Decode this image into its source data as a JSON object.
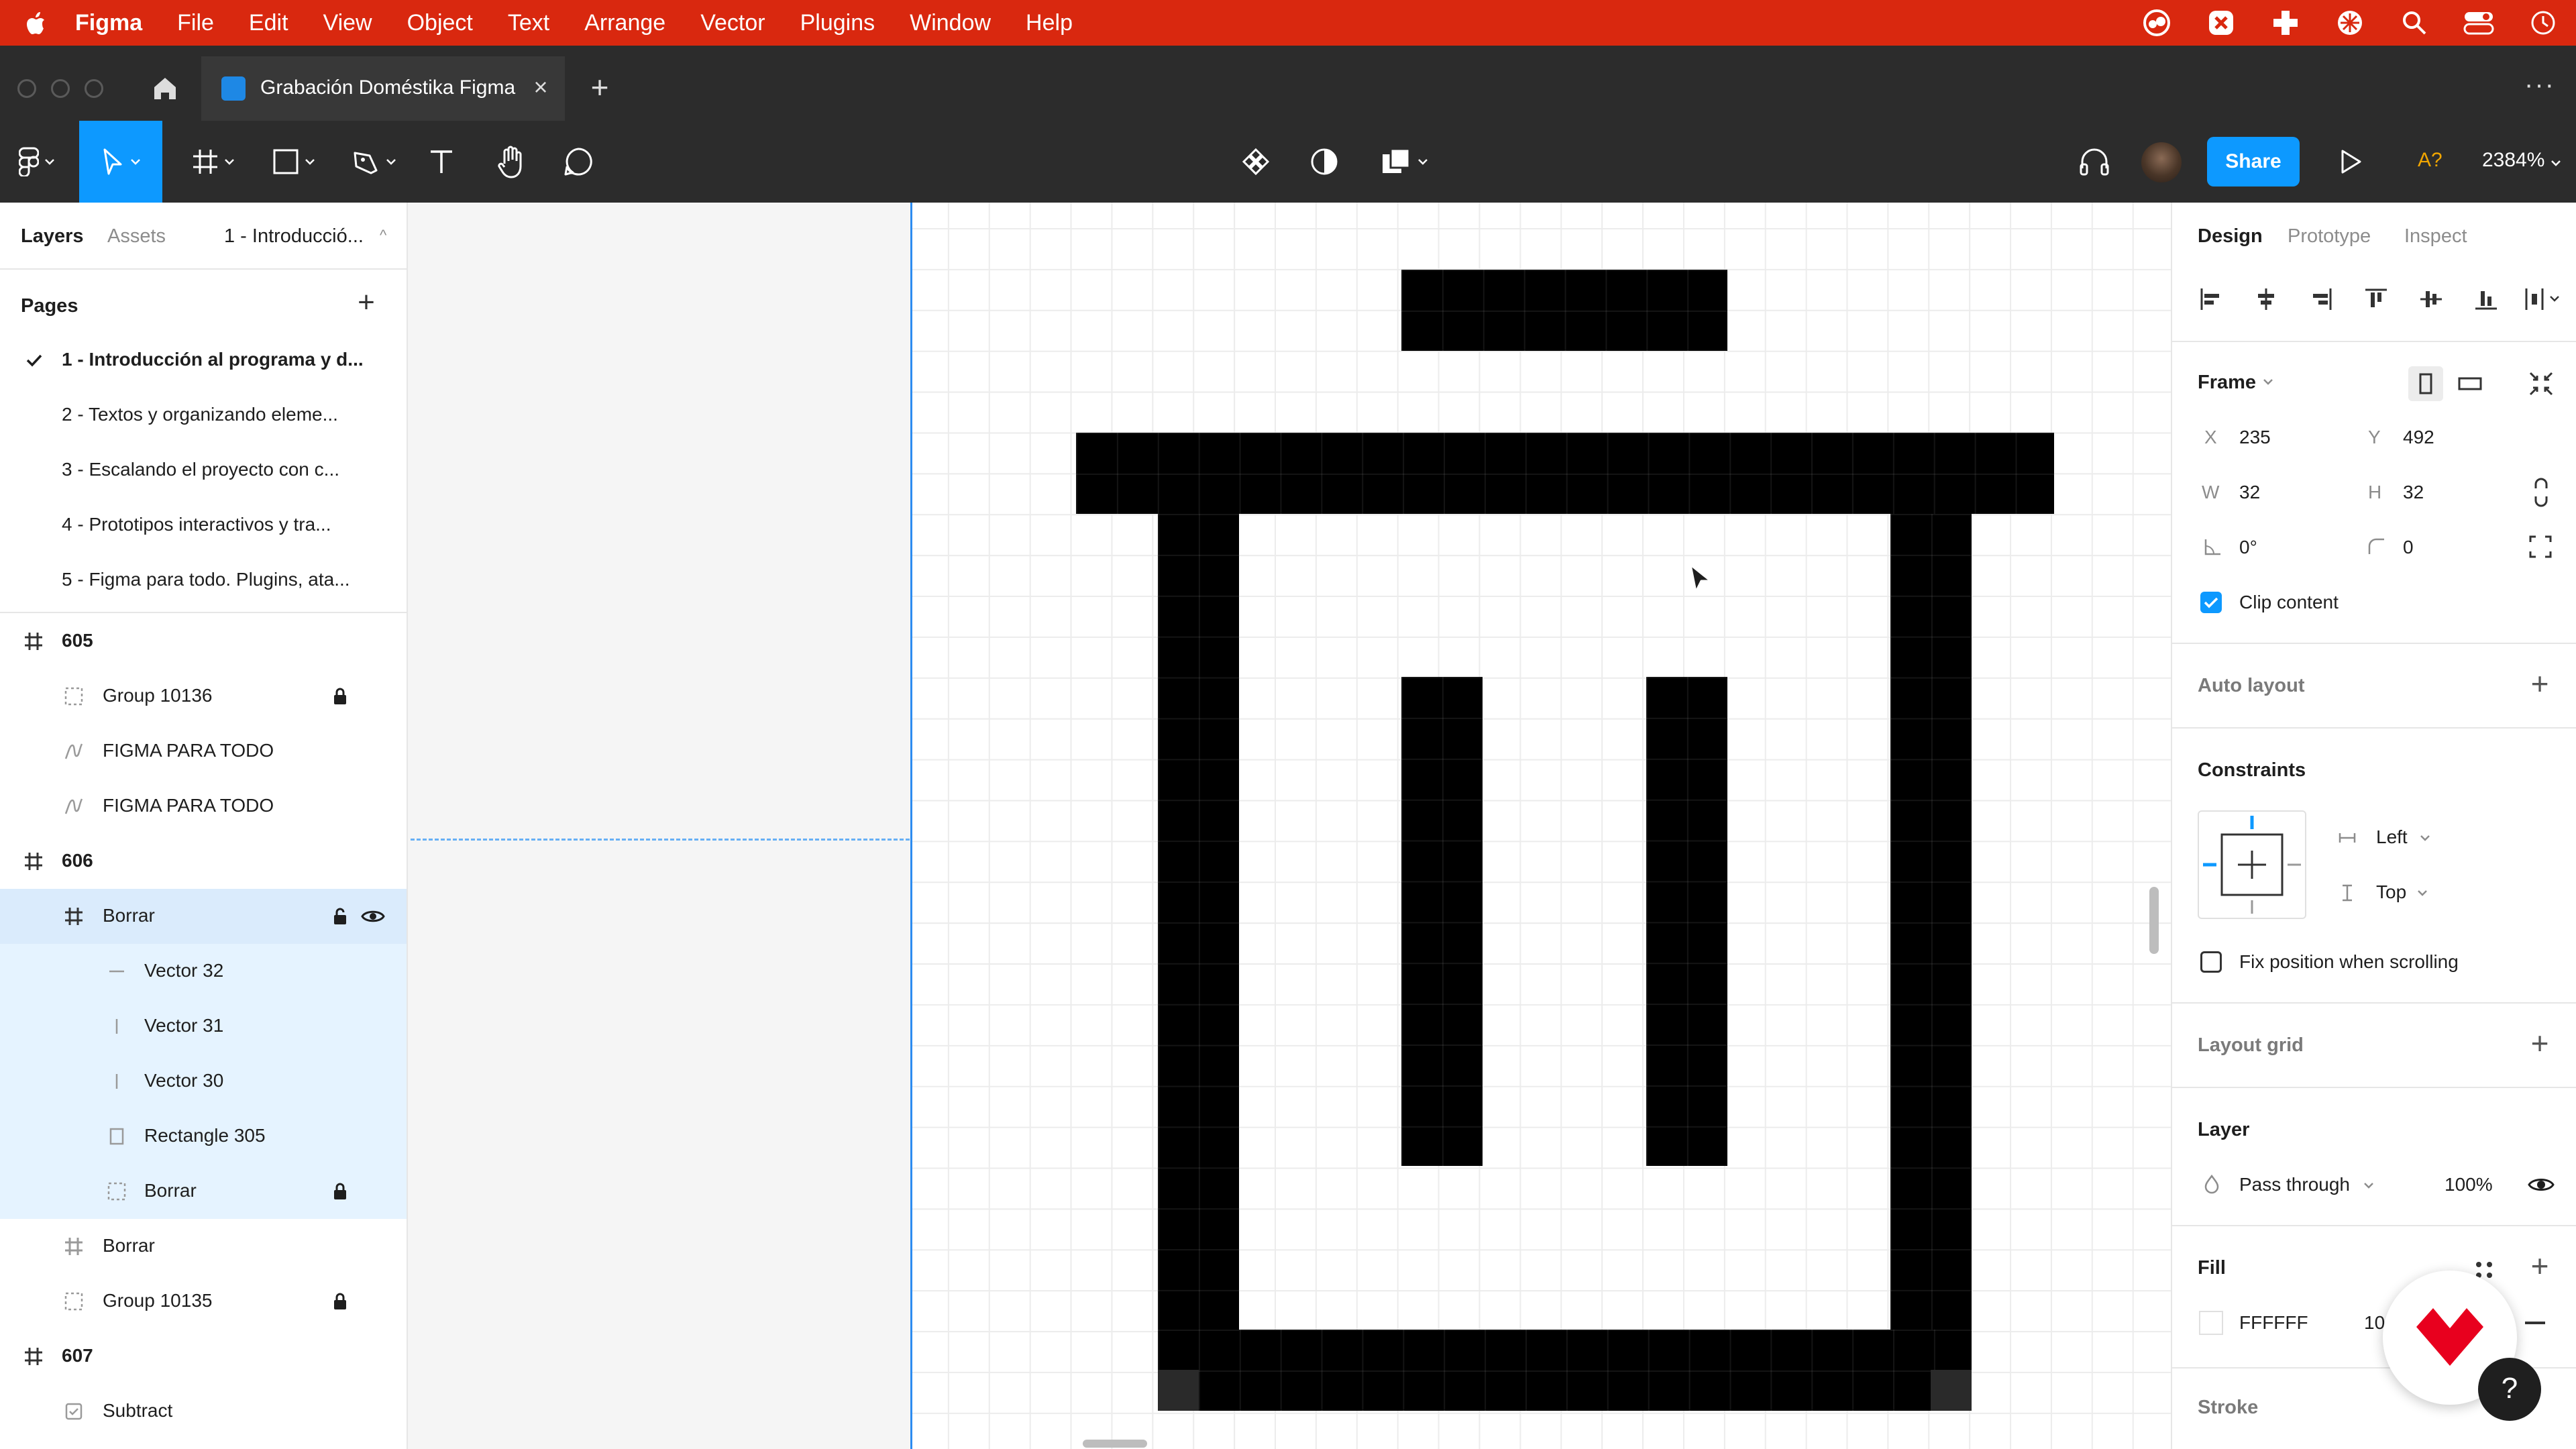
{
  "menubar": {
    "app_name": "Figma",
    "items": [
      "File",
      "Edit",
      "View",
      "Object",
      "Text",
      "Arrange",
      "Vector",
      "Plugins",
      "Window",
      "Help"
    ],
    "status_icons": [
      "creative-cloud-icon",
      "plugin-icon-1",
      "plugin-icon-2",
      "plugin-icon-3",
      "spotlight-search-icon",
      "control-center-icon",
      "clock-icon"
    ]
  },
  "tabbar": {
    "active_tab": "Grabación Doméstika Figma"
  },
  "toolbar": {
    "share_label": "Share",
    "access_label": "A?",
    "zoom": "2384%"
  },
  "left_panel": {
    "tabs": {
      "layers": "Layers",
      "assets": "Assets",
      "page": "1 - Introducció..."
    },
    "pages_title": "Pages",
    "pages": [
      "1 - Introducción al programa y d...",
      "2 - Textos y organizando eleme...",
      "3 - Escalando el proyecto con c...",
      "4 - Prototipos interactivos y tra...",
      "5 - Figma para todo. Plugins, ata..."
    ],
    "layers": [
      {
        "label": "605"
      },
      {
        "label": "Group 10136"
      },
      {
        "label": "FIGMA PARA TODO"
      },
      {
        "label": "FIGMA PARA TODO"
      },
      {
        "label": "606"
      },
      {
        "label": "Borrar"
      },
      {
        "label": "Vector 32"
      },
      {
        "label": "Vector 31"
      },
      {
        "label": "Vector 30"
      },
      {
        "label": "Rectangle 305"
      },
      {
        "label": "Borrar"
      },
      {
        "label": "Borrar"
      },
      {
        "label": "Group 10135"
      },
      {
        "label": "607"
      },
      {
        "label": "Subtract"
      }
    ]
  },
  "right_panel": {
    "tabs": {
      "design": "Design",
      "prototype": "Prototype",
      "inspect": "Inspect"
    },
    "frame": {
      "title": "Frame",
      "x_label": "X",
      "x": "235",
      "y_label": "Y",
      "y": "492",
      "w_label": "W",
      "w": "32",
      "h_label": "H",
      "h": "32",
      "rotation": "0°",
      "radius": "0",
      "clip_content": "Clip content"
    },
    "auto_layout": "Auto layout",
    "constraints": {
      "title": "Constraints",
      "horizontal": "Left",
      "vertical": "Top",
      "fix_position": "Fix position when scrolling"
    },
    "layout_grid": "Layout grid",
    "layer": {
      "title": "Layer",
      "blend": "Pass through",
      "opacity": "100%"
    },
    "fill": {
      "title": "Fill",
      "hex": "FFFFFF",
      "opacity": "10"
    },
    "stroke": "Stroke",
    "help": "?"
  },
  "colors": {
    "menubar": "#d9280f",
    "accent": "#0d99ff",
    "dark_ui": "#2c2c2c",
    "icon_fill": "#000000",
    "domestika": "#e8001e"
  }
}
